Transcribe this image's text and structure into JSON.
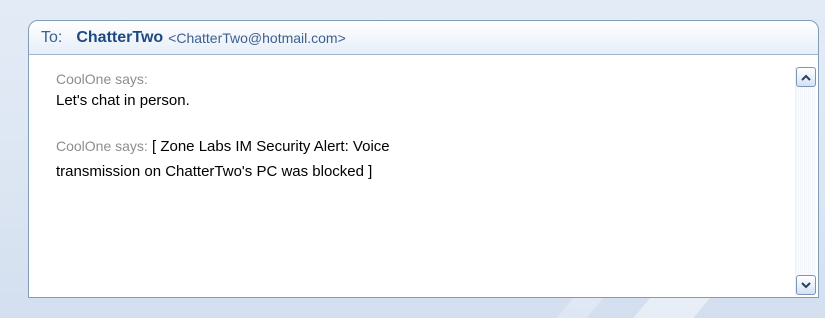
{
  "header": {
    "to_label": "To:",
    "recipient_name": "ChatterTwo",
    "recipient_email": "<ChatterTwo@hotmail.com>"
  },
  "messages": [
    {
      "speaker": "CoolOne says:",
      "text": "Let's chat in person."
    },
    {
      "speaker": "CoolOne says:",
      "text_line1": "[ Zone Labs IM Security Alert: Voice",
      "text_line2": "transmission on ChatterTwo's PC was blocked ]"
    }
  ],
  "scrollbar": {
    "up_icon": "chevron-up-icon",
    "down_icon": "chevron-down-icon"
  },
  "colors": {
    "header_text": "#1f4a80",
    "speaker_text": "#8d8d8d",
    "border": "#7f9db9"
  }
}
